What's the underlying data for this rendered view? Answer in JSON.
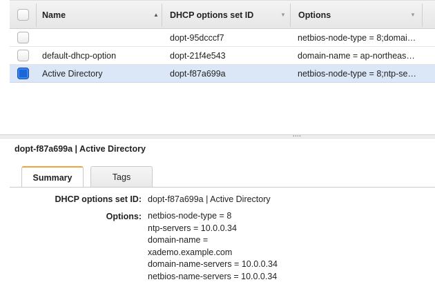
{
  "table": {
    "columns": [
      "Name",
      "DHCP options set ID",
      "Options"
    ],
    "rows": [
      {
        "name": "",
        "id": "dopt-95dcccf7",
        "options": "netbios-node-type = 8;domai…",
        "selected": false
      },
      {
        "name": "default-dhcp-option",
        "id": "dopt-21f4e543",
        "options": "domain-name = ap-northeas…",
        "selected": false
      },
      {
        "name": "Active Directory",
        "id": "dopt-f87a699a",
        "options": "netbios-node-type = 8;ntp-se…",
        "selected": true
      }
    ]
  },
  "detail": {
    "title": "dopt-f87a699a | Active Directory",
    "tabs": [
      "Summary",
      "Tags"
    ],
    "active_tab": "Summary",
    "set_id_label": "DHCP options set ID:",
    "set_id_value": "dopt-f87a699a | Active Directory",
    "options_label": "Options:",
    "options_lines": [
      "netbios-node-type = 8",
      "ntp-servers = 10.0.0.34",
      "domain-name =",
      "xademo.example.com",
      "domain-name-servers = 10.0.0.34",
      "netbios-name-servers = 10.0.0.34"
    ]
  },
  "colors": {
    "selected_row": "#dbe7f7",
    "checkbox_checked": "#1a66d9",
    "active_tab_accent": "#f0a33a"
  }
}
